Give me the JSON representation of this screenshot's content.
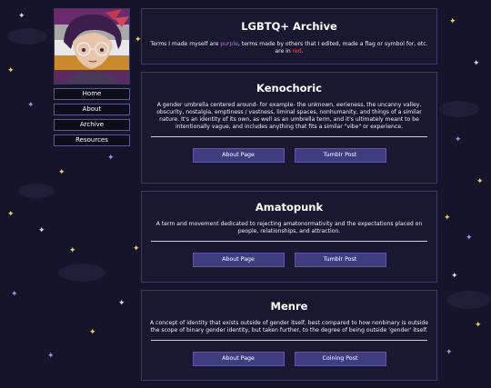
{
  "nav": {
    "items": [
      {
        "label": "Home"
      },
      {
        "label": "About"
      },
      {
        "label": "Archive"
      },
      {
        "label": "Resources"
      }
    ]
  },
  "intro": {
    "title": "LGBTQ+ Archive",
    "text_1": "Terms I made myself are ",
    "purple_word": "purple",
    "text_2": ", terms made by others that I edited, made a flag or symbol for, etc. are in ",
    "red_word": "red",
    "text_3": "."
  },
  "entries": [
    {
      "title": "Kenochoric",
      "description": "A gender umbrella centered around- for example- the unknown, eerieness, the uncanny valley, obscurity, nostalgia, emptiness / vastness, liminal spaces, nonhumanity, and things of a similar nature. It's an identity of its own, as well as an umbrella term, and it's ultimately meant to be intentionally vague, and includes anything that fits a similar \"vibe\" or experience.",
      "button_1": "About Page",
      "button_2": "Tumblr Post"
    },
    {
      "title": "Amatopunk",
      "description": "A term and movement dedicated to rejecting amatonormativity and the expectations placed on people, relationships, and attraction.",
      "button_1": "About Page",
      "button_2": "Tumblr Post"
    },
    {
      "title": "Menre",
      "description": "A concept of identity that exists outside of gender itself, best compared to how nonbinary is outside the scope of binary gender identity, but taken further, to the degree of being outside 'gender' itself.",
      "button_1": "About Page",
      "button_2": "Coining Post"
    }
  ],
  "colors": {
    "background": "#15142a",
    "card": "#1a1830",
    "button": "#3f3d80",
    "purple_highlight": "#b06ef0",
    "red_highlight": "#ff4a4a"
  },
  "icons": {
    "stars": "four-point-star-icon"
  }
}
